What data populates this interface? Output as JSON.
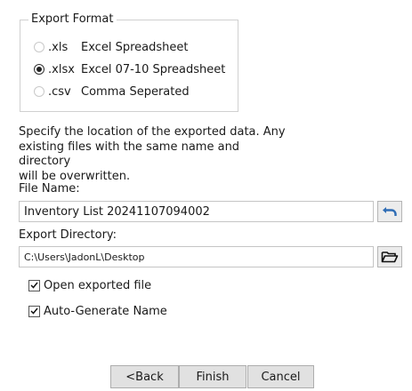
{
  "export_format": {
    "title": "Export Format",
    "options": [
      {
        "ext": ".xls",
        "desc": "Excel Spreadsheet",
        "selected": false
      },
      {
        "ext": ".xlsx",
        "desc": "Excel 07-10 Spreadsheet",
        "selected": true
      },
      {
        "ext": ".csv",
        "desc": "Comma Seperated",
        "selected": false
      }
    ]
  },
  "info": {
    "line1": "Specify the location of the exported data. Any",
    "line2": "existing files with the same name and directory",
    "line3": "will be overwritten."
  },
  "file_name": {
    "label": "File Name:",
    "value": "Inventory List 20241107094002",
    "reset_icon": "undo-arrow-icon"
  },
  "export_directory": {
    "label": "Export Directory:",
    "value": "C:\\Users\\JadonL\\Desktop",
    "browse_icon": "open-folder-icon"
  },
  "options": {
    "open_exported": {
      "label": "Open exported file",
      "checked": true
    },
    "auto_generate": {
      "label": "Auto-Generate Name",
      "checked": true
    }
  },
  "buttons": {
    "back": "<Back",
    "finish": "Finish",
    "cancel": "Cancel"
  },
  "colors": {
    "undo_icon": "#2f6db5",
    "button_face": "#e1e1e1"
  }
}
